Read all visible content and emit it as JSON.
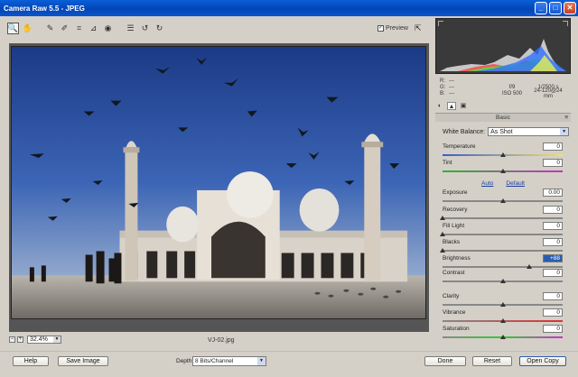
{
  "window": {
    "title": "Camera Raw 5.5  -  JPEG"
  },
  "toolbar": {
    "tools": [
      {
        "name": "zoom-tool",
        "glyph": "🔍"
      },
      {
        "name": "hand-tool",
        "glyph": "✋"
      },
      {
        "name": "eyedropper-tool",
        "glyph": "✎"
      },
      {
        "name": "color-sampler-tool",
        "glyph": "✐"
      },
      {
        "name": "crop-tool",
        "glyph": "⌗"
      },
      {
        "name": "straighten-tool",
        "glyph": "⊿"
      },
      {
        "name": "redeye-tool",
        "glyph": "◉"
      },
      {
        "name": "preferences-tool",
        "glyph": "☰"
      },
      {
        "name": "rotate-ccw-tool",
        "glyph": "↺"
      },
      {
        "name": "rotate-cw-tool",
        "glyph": "↻"
      }
    ],
    "preview_label": "Preview",
    "preview_checked": "✓"
  },
  "image": {
    "zoom_value": "32.4%",
    "filename": "VJ-02.jpg"
  },
  "histogram": {
    "r_label": "R:",
    "r_value": "---",
    "g_label": "G:",
    "g_value": "---",
    "b_label": "B:",
    "b_value": "---",
    "aperture": "f/9",
    "shutter": "1/2500 s",
    "iso": "ISO 500",
    "lens": "24-120@24 mm"
  },
  "panel": {
    "title": "Basic",
    "white_balance_label": "White Balance:",
    "white_balance_value": "As Shot",
    "auto_label": "Auto",
    "default_label": "Default",
    "sliders": [
      {
        "label": "Temperature",
        "value": "0",
        "pos": 0.5
      },
      {
        "label": "Tint",
        "value": "0",
        "pos": 0.5
      },
      {
        "label": "Exposure",
        "value": "0.00",
        "pos": 0.5
      },
      {
        "label": "Recovery",
        "value": "0",
        "pos": 0.0
      },
      {
        "label": "Fill Light",
        "value": "0",
        "pos": 0.0
      },
      {
        "label": "Blacks",
        "value": "0",
        "pos": 0.0
      },
      {
        "label": "Brightness",
        "value": "+88",
        "pos": 0.72
      },
      {
        "label": "Contrast",
        "value": "0",
        "pos": 0.5
      },
      {
        "label": "Clarity",
        "value": "0",
        "pos": 0.5
      },
      {
        "label": "Vibrance",
        "value": "0",
        "pos": 0.5
      },
      {
        "label": "Saturation",
        "value": "0",
        "pos": 0.5
      }
    ]
  },
  "bottom": {
    "help_label": "Help",
    "save_label": "Save Image",
    "depth_label": "Depth:",
    "depth_value": "8 Bits/Channel",
    "done_label": "Done",
    "reset_label": "Reset",
    "open_label": "Open Copy"
  },
  "colors": {
    "titlebar": "#0a54cc",
    "background": "#d4d0c8",
    "sky": "#2e4f9a",
    "highlight": "#2a5db0"
  }
}
